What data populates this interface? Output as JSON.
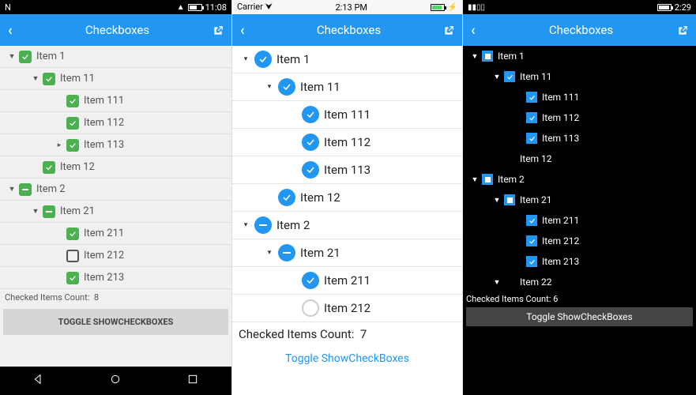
{
  "android": {
    "status": {
      "time": "11:08",
      "n_icon": "N"
    },
    "header": {
      "title": "Checkboxes"
    },
    "tree": [
      {
        "indent": 0,
        "arrow": "▼",
        "state": "checked",
        "label": "Item 1"
      },
      {
        "indent": 1,
        "arrow": "▼",
        "state": "checked",
        "label": "Item 11"
      },
      {
        "indent": 2,
        "arrow": "",
        "state": "checked",
        "label": "Item 111"
      },
      {
        "indent": 2,
        "arrow": "",
        "state": "checked",
        "label": "Item 112"
      },
      {
        "indent": 2,
        "arrow": "▸",
        "state": "checked",
        "label": "Item 113"
      },
      {
        "indent": 1,
        "arrow": "",
        "state": "checked",
        "label": "Item 12"
      },
      {
        "indent": 0,
        "arrow": "▼",
        "state": "indet",
        "label": "Item 2"
      },
      {
        "indent": 1,
        "arrow": "▼",
        "state": "indet",
        "label": "Item 21"
      },
      {
        "indent": 2,
        "arrow": "",
        "state": "checked",
        "label": "Item 211"
      },
      {
        "indent": 2,
        "arrow": "",
        "state": "unchecked",
        "label": "Item 212"
      },
      {
        "indent": 2,
        "arrow": "",
        "state": "checked",
        "label": "Item 213"
      }
    ],
    "count_label": "Checked Items Count:",
    "count_value": "8",
    "toggle_label": "TOGGLE SHOWCHECKBOXES"
  },
  "ios": {
    "status": {
      "carrier": "Carrier",
      "time": "2:13 PM"
    },
    "header": {
      "title": "Checkboxes"
    },
    "tree": [
      {
        "indent": 0,
        "arrow": "▾",
        "state": "checked",
        "label": "Item 1"
      },
      {
        "indent": 1,
        "arrow": "▾",
        "state": "checked",
        "label": "Item 11"
      },
      {
        "indent": 2,
        "arrow": "",
        "state": "checked",
        "label": "Item 111"
      },
      {
        "indent": 2,
        "arrow": "",
        "state": "checked",
        "label": "Item 112"
      },
      {
        "indent": 2,
        "arrow": "",
        "state": "checked",
        "label": "Item 113"
      },
      {
        "indent": 1,
        "arrow": "",
        "state": "checked",
        "label": "Item 12"
      },
      {
        "indent": 0,
        "arrow": "▾",
        "state": "indet",
        "label": "Item 2"
      },
      {
        "indent": 1,
        "arrow": "▾",
        "state": "indet",
        "label": "Item 21"
      },
      {
        "indent": 2,
        "arrow": "",
        "state": "checked",
        "label": "Item 211"
      },
      {
        "indent": 2,
        "arrow": "",
        "state": "unchecked",
        "label": "Item 212"
      }
    ],
    "count_label": "Checked Items Count:",
    "count_value": "7",
    "toggle_label": "Toggle ShowCheckBoxes"
  },
  "win": {
    "status": {
      "time": "2:29"
    },
    "header": {
      "title": "Checkboxes"
    },
    "tree": [
      {
        "indent": 0,
        "arrow": "▼",
        "state": "indet",
        "label": "Item 1"
      },
      {
        "indent": 1,
        "arrow": "▼",
        "state": "checked",
        "label": "Item 11"
      },
      {
        "indent": 2,
        "arrow": "",
        "state": "checked",
        "label": "Item 111"
      },
      {
        "indent": 2,
        "arrow": "",
        "state": "checked",
        "label": "Item 112"
      },
      {
        "indent": 2,
        "arrow": "",
        "state": "checked",
        "label": "Item 113"
      },
      {
        "indent": 1,
        "arrow": "",
        "state": "none",
        "label": "Item 12"
      },
      {
        "indent": 0,
        "arrow": "▼",
        "state": "indet",
        "label": "Item 2"
      },
      {
        "indent": 1,
        "arrow": "▼",
        "state": "indet",
        "label": "Item 21"
      },
      {
        "indent": 2,
        "arrow": "",
        "state": "checked",
        "label": "Item 211"
      },
      {
        "indent": 2,
        "arrow": "",
        "state": "checked",
        "label": "Item 212"
      },
      {
        "indent": 2,
        "arrow": "",
        "state": "checked",
        "label": "Item 213"
      },
      {
        "indent": 1,
        "arrow": "▼",
        "state": "none",
        "label": "Item 22"
      }
    ],
    "count_label": "Checked Items Count:",
    "count_value": "6",
    "toggle_label": "Toggle ShowCheckBoxes"
  }
}
